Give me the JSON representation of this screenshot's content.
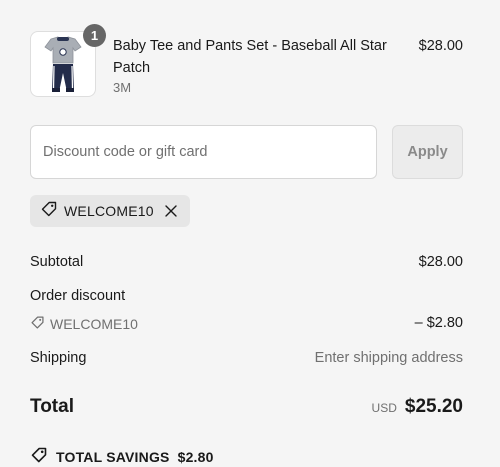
{
  "line_item": {
    "title": "Baby Tee and Pants Set - Baseball All Star Patch",
    "variant": "3M",
    "price": "$28.00",
    "quantity": "1",
    "image_icon": "baby-outfit-thumbnail"
  },
  "discount": {
    "placeholder": "Discount code or gift card",
    "value": "",
    "apply_label": "Apply",
    "applied_code": "WELCOME10",
    "tag_icon": "tag-icon",
    "remove_icon": "close-icon"
  },
  "summary": {
    "subtotal_label": "Subtotal",
    "subtotal_value": "$28.00",
    "order_discount_label": "Order discount",
    "discount_code": "WELCOME10",
    "discount_value": "– $2.80",
    "shipping_label": "Shipping",
    "shipping_value": "Enter shipping address",
    "total_label": "Total",
    "currency": "USD",
    "total_value": "$25.20",
    "savings_label": "TOTAL SAVINGS",
    "savings_value": "$2.80"
  },
  "colors": {
    "background": "#f5f5f5",
    "text": "#1a1a1a",
    "muted_text": "#707070",
    "badge": "#666666",
    "chip_background": "#e6e6e6",
    "apply_button": "#ececec"
  }
}
